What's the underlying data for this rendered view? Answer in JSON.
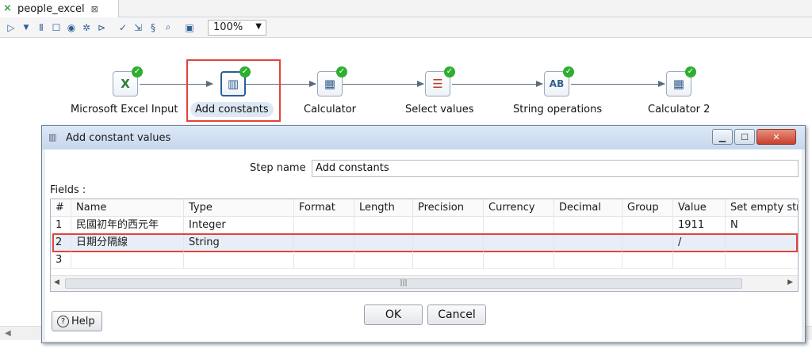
{
  "tab": {
    "title": "people_excel",
    "close_glyph": "⊠"
  },
  "toolbar": {
    "zoom_value": "100%"
  },
  "steps": [
    {
      "label": "Microsoft Excel Input",
      "icon": "excel-input-icon"
    },
    {
      "label": "Add constants",
      "icon": "add-constants-icon"
    },
    {
      "label": "Calculator",
      "icon": "calculator-icon"
    },
    {
      "label": "Select values",
      "icon": "select-values-icon"
    },
    {
      "label": "String operations",
      "icon": "string-operations-icon"
    },
    {
      "label": "Calculator 2",
      "icon": "calculator-icon"
    }
  ],
  "dialog": {
    "title": "Add constant values",
    "step_name_label": "Step name",
    "step_name_value": "Add constants",
    "fields_label": "Fields :",
    "columns": [
      "#",
      "Name",
      "Type",
      "Format",
      "Length",
      "Precision",
      "Currency",
      "Decimal",
      "Group",
      "Value",
      "Set empty str"
    ],
    "rows": [
      {
        "num": "1",
        "name": "民國初年的西元年",
        "type": "Integer",
        "format": "",
        "length": "",
        "precision": "",
        "currency": "",
        "decimal": "",
        "group": "",
        "value": "1911",
        "set_empty": "N"
      },
      {
        "num": "2",
        "name": "日期分隔線",
        "type": "String",
        "format": "",
        "length": "",
        "precision": "",
        "currency": "",
        "decimal": "",
        "group": "",
        "value": "/",
        "set_empty": ""
      },
      {
        "num": "3",
        "name": "",
        "type": "",
        "format": "",
        "length": "",
        "precision": "",
        "currency": "",
        "decimal": "",
        "group": "",
        "value": "",
        "set_empty": ""
      }
    ],
    "ok_label": "OK",
    "cancel_label": "Cancel",
    "help_label": "Help"
  },
  "colors": {
    "highlight": "#e0443a",
    "ok_badge": "#2fae2f"
  }
}
